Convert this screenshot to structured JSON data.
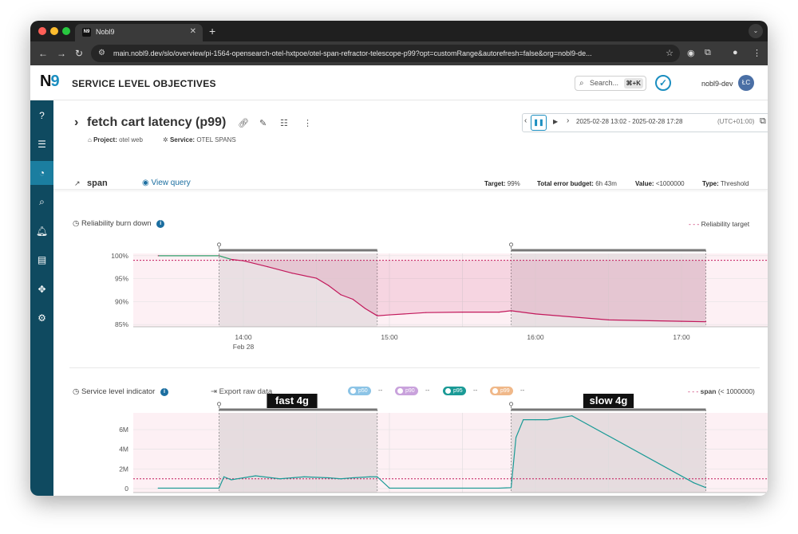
{
  "browser": {
    "tab_title": "Nobl9",
    "tab_favicon": "N9",
    "url": "main.nobl9.dev/slo/overview/pi-1564-opensearch-otel-hxtpoe/otel-span-refractor-telescope-p99?opt=customRange&autorefresh=false&org=nobl9-de..."
  },
  "app": {
    "logo": "N9",
    "title": "SERVICE LEVEL OBJECTIVES",
    "search_placeholder": "Search...",
    "search_shortcut": "⌘+K",
    "org": "nobl9-dev",
    "avatar_initials": "ŁC",
    "accent_color": "#1b8ec0",
    "sidebar_color": "#0f4a60"
  },
  "sidebar": {
    "items": [
      "help-icon",
      "list-icon",
      "slo-icon",
      "search-icon",
      "bell-icon",
      "report-icon",
      "integrations-icon",
      "settings-icon"
    ],
    "active": 2
  },
  "slo": {
    "title": "fetch cart latency (p99)",
    "project_label": "Project:",
    "project": "otel web",
    "service_label": "Service:",
    "service": "OTEL SPANS",
    "time_range": "2025-02-28 13:02 - 2025-02-28 17:28",
    "timezone": "(UTC+01:00)",
    "objective_name": "span",
    "view_query": "View query",
    "target_label": "Target:",
    "target": "99%",
    "error_budget_label": "Total error budget:",
    "error_budget": "6h 43m",
    "value_label": "Value:",
    "value": "<1000000",
    "type_label": "Type:",
    "type": "Threshold"
  },
  "burn_down": {
    "title": "Reliability burn down",
    "legend": "Reliability target"
  },
  "sli": {
    "title": "Service level indicator",
    "export": "Export raw data",
    "pills": [
      {
        "label": "p50",
        "color": "#8cc4e6",
        "value": "--"
      },
      {
        "label": "p90",
        "color": "#c9a2dc",
        "value": "--"
      },
      {
        "label": "p95",
        "color": "#1a9a96",
        "value": "--"
      },
      {
        "label": "p99",
        "color": "#f0b889",
        "value": "--"
      }
    ],
    "legend_name": "span",
    "legend_suffix": "(< 1000000)"
  },
  "annotations": {
    "fast": "fast 4g",
    "slow": "slow 4g"
  },
  "chart_data": [
    {
      "type": "line",
      "title": "Reliability burn down",
      "x": [
        "13:25",
        "13:50",
        "13:55",
        "14:00",
        "14:10",
        "14:20",
        "14:30",
        "14:35",
        "14:40",
        "14:45",
        "14:50",
        "14:55",
        "15:00",
        "15:15",
        "15:30",
        "15:45",
        "15:50",
        "16:00",
        "16:30",
        "17:00",
        "17:10"
      ],
      "x_ticks": [
        "14:00",
        "15:00",
        "16:00",
        "17:00"
      ],
      "x_tick_sub": "Feb 28",
      "y_ticks": [
        "100%",
        "95%",
        "90%",
        "85%"
      ],
      "ylim": [
        84.5,
        100.5
      ],
      "series": [
        {
          "name": "Reliability",
          "values": [
            100,
            100,
            99.2,
            98.9,
            97.6,
            96.2,
            95.1,
            93.5,
            91.5,
            90.5,
            88.5,
            86.9,
            87.1,
            87.6,
            87.7,
            87.7,
            88.0,
            87.3,
            86.0,
            85.7,
            85.6
          ]
        },
        {
          "name": "Reliability target",
          "value": 99
        }
      ],
      "highlight_ranges": [
        [
          "13:50",
          "14:55"
        ],
        [
          "15:50",
          "17:10"
        ]
      ]
    },
    {
      "type": "line",
      "title": "Service level indicator",
      "x": [
        "13:25",
        "13:50",
        "13:52",
        "13:55",
        "14:05",
        "14:15",
        "14:25",
        "14:35",
        "14:40",
        "14:45",
        "14:52",
        "14:55",
        "15:00",
        "15:45",
        "15:50",
        "15:52",
        "15:55",
        "16:00",
        "16:05",
        "16:15",
        "17:05",
        "17:10"
      ],
      "y_ticks": [
        "6M",
        "4M",
        "2M",
        "0"
      ],
      "ylim": [
        -0.4,
        7.7
      ],
      "y_unit": "M",
      "series": [
        {
          "name": "span",
          "values": [
            0.05,
            0.05,
            1.2,
            0.9,
            1.3,
            1.0,
            1.2,
            1.1,
            1.0,
            1.1,
            1.2,
            1.2,
            0.05,
            0.05,
            0.1,
            5.2,
            7.0,
            7.0,
            7.0,
            7.4,
            0.6,
            0.1
          ]
        },
        {
          "name": "span (< 1000000)",
          "value": 1.0
        }
      ],
      "highlight_ranges": [
        [
          "13:50",
          "14:55"
        ],
        [
          "15:50",
          "17:10"
        ]
      ]
    }
  ]
}
